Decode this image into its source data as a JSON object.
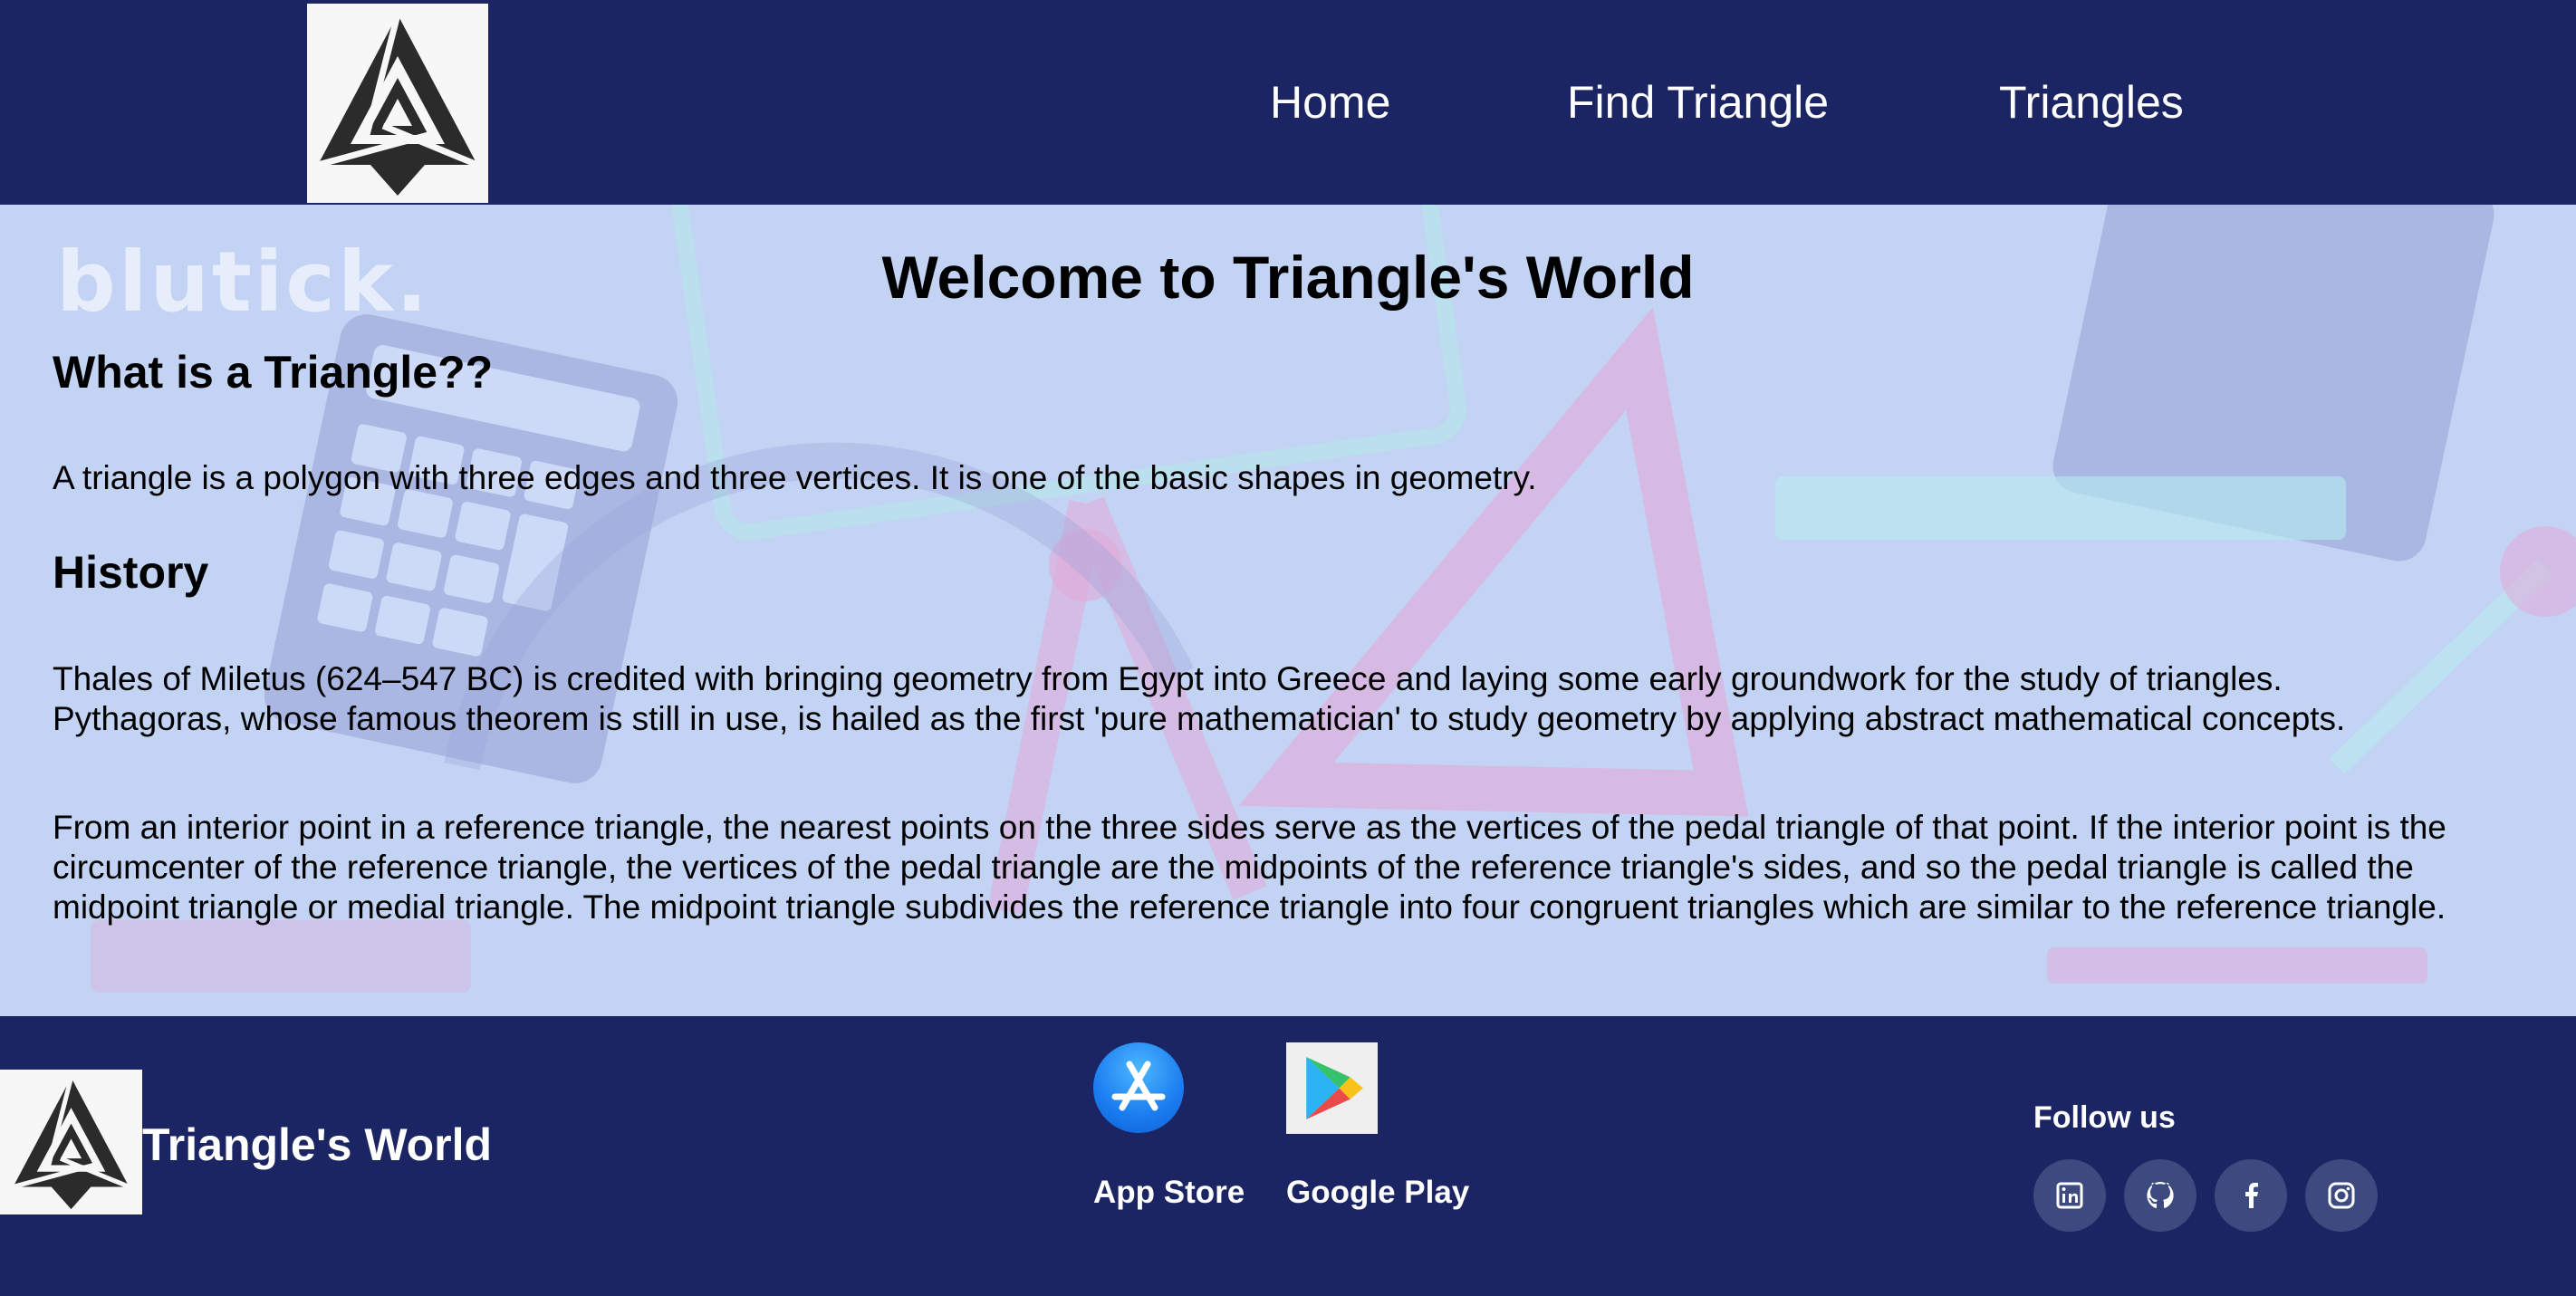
{
  "header": {
    "logo_icon": "triangle-knot-logo-icon",
    "nav": {
      "home": "Home",
      "find_triangle": "Find Triangle",
      "triangles": "Triangles"
    }
  },
  "main": {
    "watermark": "blutick.",
    "title": "Welcome to Triangle's World",
    "what_heading": "What is a Triangle??",
    "what_text": "A triangle is a polygon with three edges and three vertices. It is one of the basic shapes in geometry.",
    "history_heading": "History",
    "history_p1": "Thales of Miletus (624–547 BC) is credited with bringing geometry from Egypt into Greece and laying some early groundwork for the study of triangles.",
    "history_p2": "Pythagoras, whose famous theorem is still in use, is hailed as the first 'pure mathematician' to study geometry by applying abstract mathematical concepts.",
    "pedal_text": "From an interior point in a reference triangle, the nearest points on the three sides serve as the vertices of the pedal triangle of that point. If the interior point is the circumcenter of the reference triangle, the vertices of the pedal triangle are the midpoints of the reference triangle's sides, and so the pedal triangle is called the midpoint triangle or medial triangle. The midpoint triangle subdivides the reference triangle into four congruent triangles which are similar to the reference triangle."
  },
  "footer": {
    "site_name": "Triangle's World",
    "app_store_label": "App Store",
    "google_play_label": "Google Play",
    "follow_label": "Follow us",
    "social_icons": [
      "linkedin-icon",
      "github-icon",
      "facebook-icon",
      "instagram-icon"
    ]
  },
  "colors": {
    "header_bg": "#1c2563",
    "main_bg": "#c3d3f4",
    "footer_bg": "#1c2563",
    "social_bg": "#3d4a80",
    "text_light": "#ffffff",
    "text_dark": "#000000"
  }
}
